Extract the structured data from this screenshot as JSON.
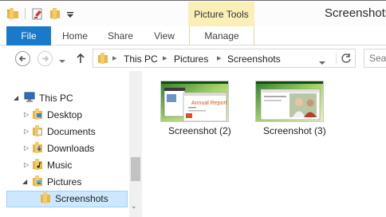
{
  "window": {
    "title": "Screenshots"
  },
  "ribbon": {
    "context_group": "Picture Tools",
    "tabs": {
      "file": "File",
      "home": "Home",
      "share": "Share",
      "view": "View",
      "manage": "Manage"
    }
  },
  "address": {
    "crumbs": [
      "This PC",
      "Pictures",
      "Screenshots"
    ]
  },
  "search": {
    "placeholder": "Sea"
  },
  "nav_pane": {
    "items": [
      {
        "label": "This PC"
      },
      {
        "label": "Desktop"
      },
      {
        "label": "Documents"
      },
      {
        "label": "Downloads"
      },
      {
        "label": "Music"
      },
      {
        "label": "Pictures"
      },
      {
        "label": "Screenshots",
        "selected": true
      }
    ]
  },
  "files": [
    {
      "name": "Screenshot (2)",
      "thumb_title": "Annual Report"
    },
    {
      "name": "Screenshot (3)"
    }
  ],
  "colors": {
    "accent": "#1979ca",
    "contextual_tab": "#f9efb7",
    "selection": "#cce8ff",
    "folder": "#e8b64a"
  }
}
